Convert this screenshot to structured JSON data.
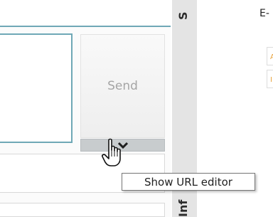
{
  "compose": {
    "send_label": "Send",
    "url_toggle_icon": "chevron-down-icon",
    "tooltip": "Show URL editor"
  },
  "sidebar_tabs": {
    "top_label": "S",
    "bottom_label": "Inf"
  },
  "right_panel": {
    "label": "E-",
    "box1_char": "A",
    "box2_char": "I"
  },
  "colors": {
    "accent_border": "#6fa8b6",
    "toggle_bg": "#c8ccce",
    "strip_bg": "#e4e4e4"
  }
}
